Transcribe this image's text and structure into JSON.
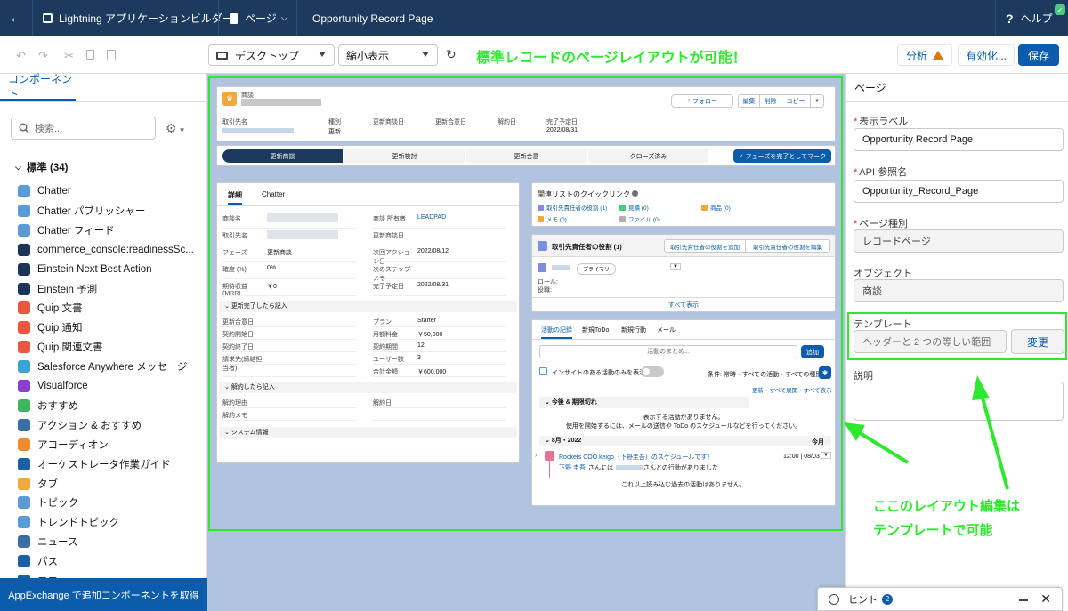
{
  "topbar": {
    "app_title": "Lightning アプリケーションビルダー",
    "page_menu": "ページ",
    "record_page": "Opportunity Record Page",
    "help": "ヘルプ"
  },
  "toolbar": {
    "device": "デスクトップ",
    "zoom": "縮小表示",
    "analyze": "分析",
    "activate": "有効化...",
    "save": "保存"
  },
  "annotations": {
    "headline": "標準レコードのページレイアウトが可能！",
    "note_line1": "ここのレイアウト編集は",
    "note_line2": "テンプレートで可能"
  },
  "left_panel": {
    "tab": "コンポーネント",
    "search_placeholder": "検索...",
    "section": "標準 (34)",
    "components": [
      {
        "label": "Chatter",
        "color": "#5a9bd8",
        "icon": "chatter-icon"
      },
      {
        "label": "Chatter パブリッシャー",
        "color": "#5a9bd8",
        "icon": "chatter-publisher-icon"
      },
      {
        "label": "Chatter フィード",
        "color": "#5a9bd8",
        "icon": "chatter-feed-icon"
      },
      {
        "label": "commerce_console:readinessSc...",
        "color": "#1a3557",
        "icon": "lightning-bolt-icon"
      },
      {
        "label": "Einstein Next Best Action",
        "color": "#1a3557",
        "icon": "einstein-icon"
      },
      {
        "label": "Einstein 予測",
        "color": "#1a3557",
        "icon": "einstein-prediction-icon"
      },
      {
        "label": "Quip 文書",
        "color": "#e9573f",
        "icon": "quip-icon"
      },
      {
        "label": "Quip 通知",
        "color": "#e9573f",
        "icon": "quip-notification-icon"
      },
      {
        "label": "Quip 関連文書",
        "color": "#e9573f",
        "icon": "quip-related-icon"
      },
      {
        "label": "Salesforce Anywhere メッセージ",
        "color": "#3aa3d8",
        "icon": "message-icon"
      },
      {
        "label": "Visualforce",
        "color": "#8a3fd1",
        "icon": "visualforce-icon"
      },
      {
        "label": "おすすめ",
        "color": "#3fb55e",
        "icon": "lightbulb-icon"
      },
      {
        "label": "アクション & おすすめ",
        "color": "#3a6ea5",
        "icon": "actions-icon"
      },
      {
        "label": "アコーディオン",
        "color": "#f28b30",
        "icon": "accordion-icon"
      },
      {
        "label": "オーケストレータ作業ガイド",
        "color": "#1b5fa8",
        "icon": "orchestrator-icon"
      },
      {
        "label": "タブ",
        "color": "#f2a93b",
        "icon": "tab-icon"
      },
      {
        "label": "トピック",
        "color": "#5a9bd8",
        "icon": "topic-icon"
      },
      {
        "label": "トレンドトピック",
        "color": "#5a9bd8",
        "icon": "trending-topic-icon"
      },
      {
        "label": "ニュース",
        "color": "#3a6ea5",
        "icon": "news-icon"
      },
      {
        "label": "パス",
        "color": "#1b5fa8",
        "icon": "path-icon"
      },
      {
        "label": "フロー",
        "color": "#1b5fa8",
        "icon": "flow-icon"
      }
    ],
    "appexchange": "AppExchange で追加コンポーネントを取得"
  },
  "record": {
    "object_label": "商談",
    "highlights": {
      "follow": "フォロー",
      "edit": "編集",
      "delete": "削除",
      "copy": "コピー",
      "fields": [
        {
          "label": "取引先名",
          "value": ""
        },
        {
          "label": "種別",
          "value": "更新"
        },
        {
          "label": "更新商談日",
          "value": ""
        },
        {
          "label": "更新合意日",
          "value": ""
        },
        {
          "label": "解約日",
          "value": ""
        },
        {
          "label": "完了予定日",
          "value": "2022/08/31"
        }
      ]
    },
    "path": {
      "stages": [
        "更新商談",
        "更新検討",
        "更新合意",
        "クローズ済み"
      ],
      "complete_button": "フェーズを完了としてマーク"
    },
    "details": {
      "tab_detail": "詳細",
      "tab_chatter": "Chatter",
      "rows": [
        {
          "l1": "商談名",
          "v1": "",
          "l2": "商談 所有者",
          "v2": "LEADPAD"
        },
        {
          "l1": "取引先名",
          "v1": "",
          "l2": "更新商談日",
          "v2": ""
        },
        {
          "l1": "フェーズ",
          "v1": "更新商談",
          "l2": "次回アクション日",
          "v2": "2022/08/12"
        },
        {
          "l1": "確度 (%)",
          "v1": "0%",
          "l2": "次のステップメモ",
          "v2": ""
        },
        {
          "l1": "期待収益 (MRR)",
          "v1": "￥0",
          "l2": "完了予定日",
          "v2": "2022/08/31"
        }
      ],
      "section1": "更新完了したら記入",
      "rows2": [
        {
          "l1": "更新合意日",
          "v1": "",
          "l2": "プラン",
          "v2": "Starter"
        },
        {
          "l1": "契約開始日",
          "v1": "",
          "l2": "月額料金",
          "v2": "￥50,000"
        },
        {
          "l1": "契約終了日",
          "v1": "",
          "l2": "契約期間",
          "v2": "12"
        },
        {
          "l1": "請求先(締結担当者)",
          "v1": "",
          "l2": "ユーザー数",
          "v2": "3"
        },
        {
          "l1": "",
          "v1": "",
          "l2": "合計金額",
          "v2": "￥600,000"
        }
      ],
      "section2": "解約したら記入",
      "rows3": [
        {
          "l1": "解約理由",
          "v1": "",
          "l2": "解約日",
          "v2": ""
        },
        {
          "l1": "解約メモ",
          "v1": "",
          "l2": "",
          "v2": ""
        }
      ],
      "section3": "システム情報"
    },
    "quicklinks": {
      "title": "関連リストのクイックリンク",
      "links": [
        "取引先責任者の役割 (1)",
        "見積 (0)",
        "商品 (0)",
        "メモ (0)",
        "ファイル (0)"
      ]
    },
    "contact_roles": {
      "title": "取引先責任者の役割 (1)",
      "add": "取引先責任者の役割を追加",
      "edit": "取引先責任者の役割を編集",
      "badge": "プライマリ",
      "role": "ロール:",
      "title_field": "役職:",
      "view_all": "すべて表示"
    },
    "activity": {
      "tabs": [
        "活動の記録",
        "新規ToDo",
        "新規行動",
        "メール"
      ],
      "placeholder": "活動のまとめ...",
      "add": "追加",
      "insight": "インサイトのある活動のみを表示",
      "filter": "条件: 常時・すべての活動・すべての種別",
      "refresh_links": "更新・すべて展開・すべて表示",
      "upcoming": "今後 & 期限切れ",
      "no_activity": "表示する活動がありません。",
      "hint": "使用を開始するには、メールの送信や ToDo のスケジュールなどを行ってください。",
      "month": "8月・2022",
      "this_month": "今月",
      "event_title": "Rockets COO keigo（下野圭吾）のスケジュールです！",
      "event_time": "12:00 | 08/03",
      "event_who": "下野 圭吾",
      "event_desc1": "さんには",
      "event_desc2": "さんとの行動がありました",
      "no_more": "これ以上読み込む過去の活動はありません。"
    }
  },
  "right_panel": {
    "title": "ページ",
    "label_title": "表示ラベル",
    "label_value": "Opportunity Record Page",
    "api_title": "API 参照名",
    "api_value": "Opportunity_Record_Page",
    "type_title": "ページ種別",
    "type_value": "レコードページ",
    "object_title": "オブジェクト",
    "object_value": "商談",
    "template_title": "テンプレート",
    "template_value": "ヘッダーと 2 つの等しい範囲",
    "template_change": "変更",
    "desc_title": "説明"
  },
  "hint": {
    "label": "ヒント",
    "count": "2"
  }
}
